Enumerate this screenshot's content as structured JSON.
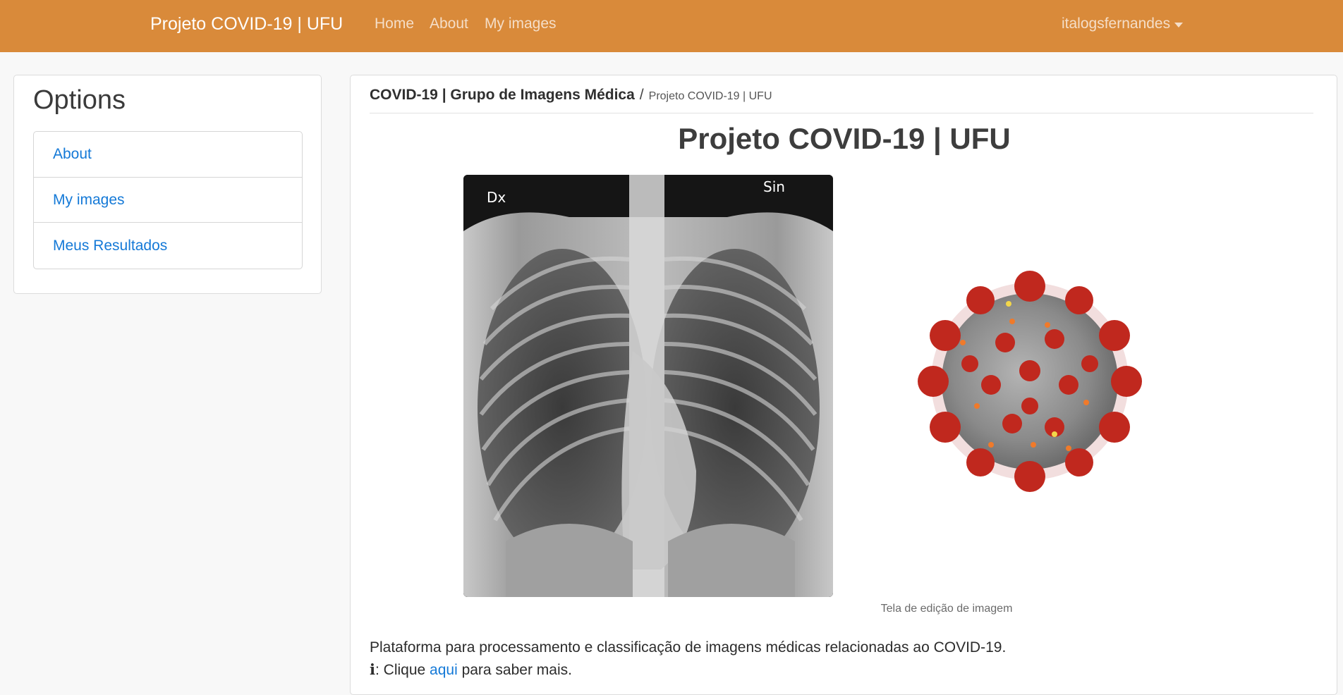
{
  "navbar": {
    "brand": "Projeto COVID-19 | UFU",
    "links": [
      "Home",
      "About",
      "My images"
    ],
    "user": "italogsfernandes",
    "bg_color": "#d98a3a"
  },
  "sidebar": {
    "title": "Options",
    "items": [
      {
        "label": "About"
      },
      {
        "label": "My images"
      },
      {
        "label": "Meus Resultados"
      }
    ]
  },
  "main": {
    "breadcrumb": {
      "main": "COVID-19 | Grupo de Imagens Médica",
      "separator": "/",
      "sub": "Projeto COVID-19 | UFU"
    },
    "title": "Projeto COVID-19 | UFU",
    "xray_labels": {
      "left": "Dx",
      "right": "Sin"
    },
    "caption": "Tela de edição de imagem",
    "description": "Plataforma para processamento e classificação de imagens médicas relacionadas ao COVID-19.",
    "info": {
      "icon": "info-icon",
      "prefix": ": Clique ",
      "link": "aqui",
      "suffix": " para saber mais."
    }
  }
}
